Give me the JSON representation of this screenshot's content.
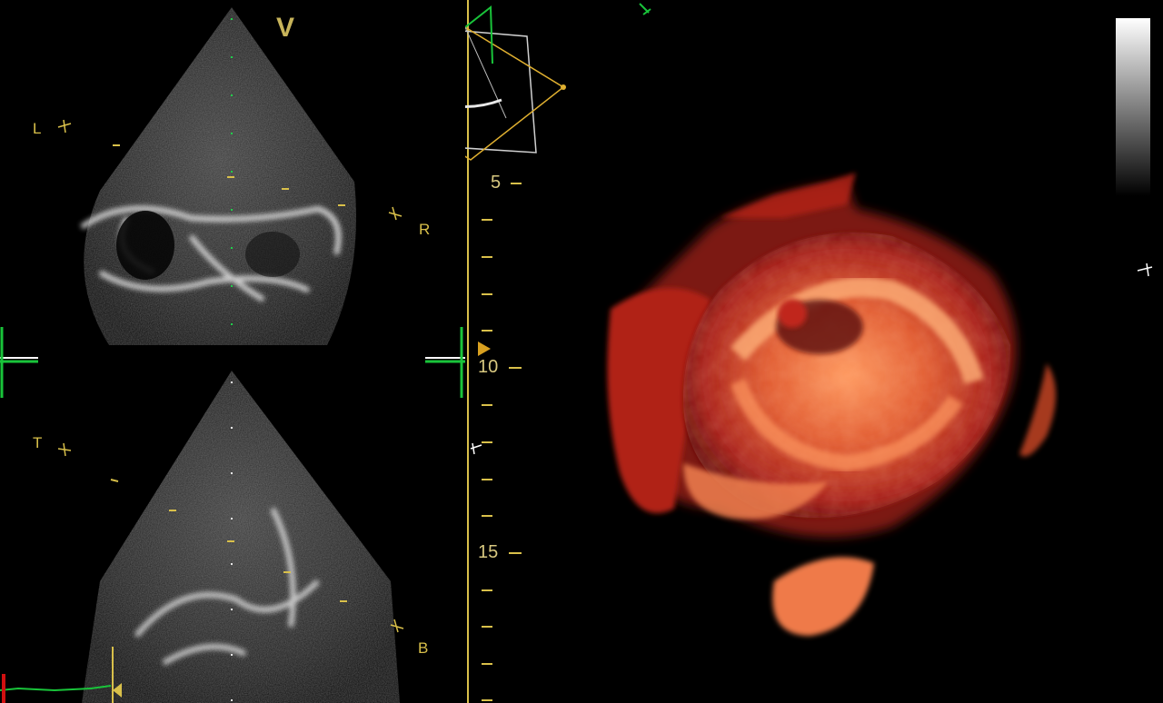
{
  "labels": {
    "view": "V",
    "upper_left": "L",
    "upper_right": "R",
    "lower_left": "T",
    "lower_right": "B"
  },
  "depth_scale": {
    "marks": [
      "5",
      "10",
      "15"
    ]
  },
  "colors": {
    "annotation": "#d9c04a",
    "plane_green": "#19c43a",
    "cube_white": "#d0d0d0",
    "render_red": "#c0281a",
    "render_orange": "#f07a45"
  },
  "icons": [
    "tick-mark-icon",
    "crosshair-icon",
    "depth-pointer-icon",
    "grayscale-bar-icon"
  ]
}
